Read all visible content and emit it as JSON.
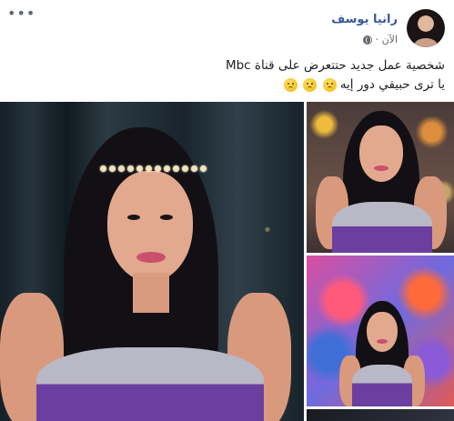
{
  "post": {
    "author_name": "رانيا يوسف",
    "timestamp": "الآن ·",
    "privacy_icon": "globe-icon",
    "more_icon": "more-options-icon",
    "text_lines": [
      "شخصية عمل جديد حتتعرض  على قناة Mbc",
      "يا ترى حبيقي دور إيه"
    ],
    "emoji_count": 3,
    "colors": {
      "author": "#385898",
      "meta": "#606770",
      "text": "#1c1e21",
      "dress_purple": "#6b3fa0"
    }
  },
  "photos": [
    {
      "name": "main-photo"
    },
    {
      "name": "photo-top-right"
    },
    {
      "name": "photo-mid-right"
    },
    {
      "name": "photo-bottom-right"
    }
  ]
}
